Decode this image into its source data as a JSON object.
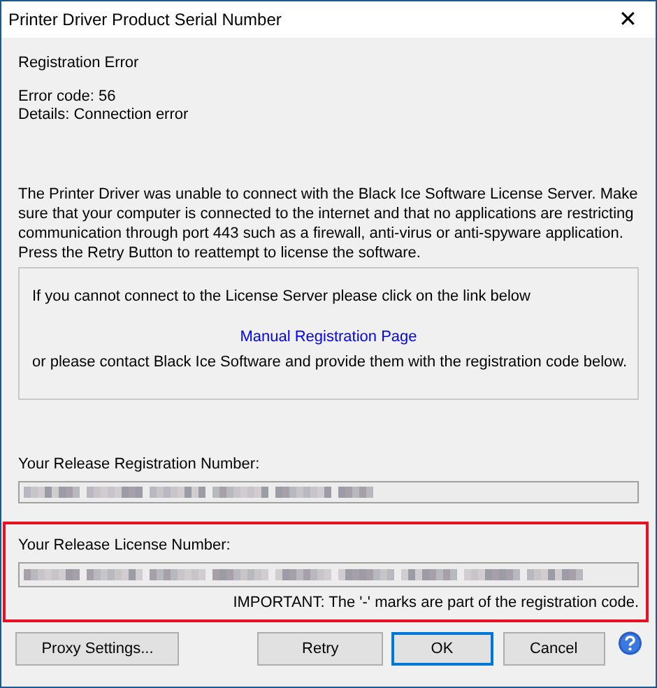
{
  "window": {
    "title": "Printer Driver Product Serial Number",
    "close": "✕"
  },
  "heading": "Registration Error",
  "error_lines": [
    "Error code: 56",
    "Details: Connection error"
  ],
  "message": "The Printer Driver was unable to connect with the Black Ice Software License Server. Make sure that your computer is connected to the internet and that no applications are restricting communication through port 443 such as a firewall, anti-virus or anti-spyware application. Press the Retry Button to reattempt to license the software.",
  "manual_box": {
    "intro": "If you cannot connect to the License Server please click on the link below",
    "link": "Manual Registration Page",
    "outro": "or please contact Black Ice Software and provide them with the registration code below."
  },
  "registration": {
    "label": "Your Release Registration Number:",
    "redacted": true
  },
  "license": {
    "label": "Your Release License Number:",
    "redacted": true,
    "highlighted": true,
    "note": "IMPORTANT: The '-' marks are part of the registration code."
  },
  "buttons": [
    {
      "label": "Proxy Settings...",
      "default": false
    },
    {
      "label": "Retry",
      "default": false
    },
    {
      "label": "OK",
      "default": true
    },
    {
      "label": "Cancel",
      "default": false
    }
  ]
}
